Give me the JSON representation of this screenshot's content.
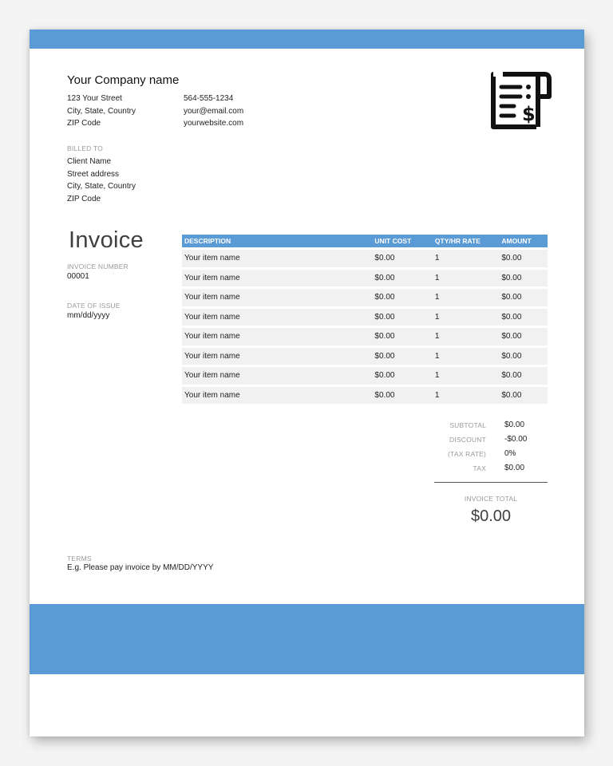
{
  "colors": {
    "accent": "#5b9bd5",
    "row_bg": "#f1f1f1",
    "label_gray": "#9a9a9a"
  },
  "company": {
    "name": "Your Company name",
    "address": [
      "123 Your Street",
      "City, State, Country",
      "ZIP Code"
    ],
    "contact": [
      "564-555-1234",
      "your@email.com",
      "yourwebsite.com"
    ],
    "logo_icon": "invoice-receipt-dollar-icon"
  },
  "billed_to": {
    "label": "BILLED TO",
    "lines": [
      "Client Name",
      "Street address",
      "City, State, Country",
      "ZIP Code"
    ]
  },
  "invoice": {
    "title": "Invoice",
    "number_label": "INVOICE NUMBER",
    "number": "00001",
    "date_label": "DATE OF ISSUE",
    "date": "mm/dd/yyyy"
  },
  "table": {
    "headers": [
      "DESCRIPTION",
      "UNIT COST",
      "QTY/HR RATE",
      "AMOUNT"
    ],
    "rows": [
      [
        "Your item name",
        "$0.00",
        "1",
        "$0.00"
      ],
      [
        "Your item name",
        "$0.00",
        "1",
        "$0.00"
      ],
      [
        "Your item name",
        "$0.00",
        "1",
        "$0.00"
      ],
      [
        "Your item name",
        "$0.00",
        "1",
        "$0.00"
      ],
      [
        "Your item name",
        "$0.00",
        "1",
        "$0.00"
      ],
      [
        "Your item name",
        "$0.00",
        "1",
        "$0.00"
      ],
      [
        "Your item name",
        "$0.00",
        "1",
        "$0.00"
      ],
      [
        "Your item name",
        "$0.00",
        "1",
        "$0.00"
      ]
    ]
  },
  "totals": {
    "subtotal_label": "SUBTOTAL",
    "subtotal": "$0.00",
    "discount_label": "DISCOUNT",
    "discount": "-$0.00",
    "tax_rate_label": "(TAX RATE)",
    "tax_rate": "0%",
    "tax_label": "TAX",
    "tax": "$0.00",
    "invoice_total_label": "INVOICE TOTAL",
    "invoice_total": "$0.00"
  },
  "terms": {
    "label": "TERMS",
    "text": "E.g. Please pay invoice by MM/DD/YYYY"
  }
}
